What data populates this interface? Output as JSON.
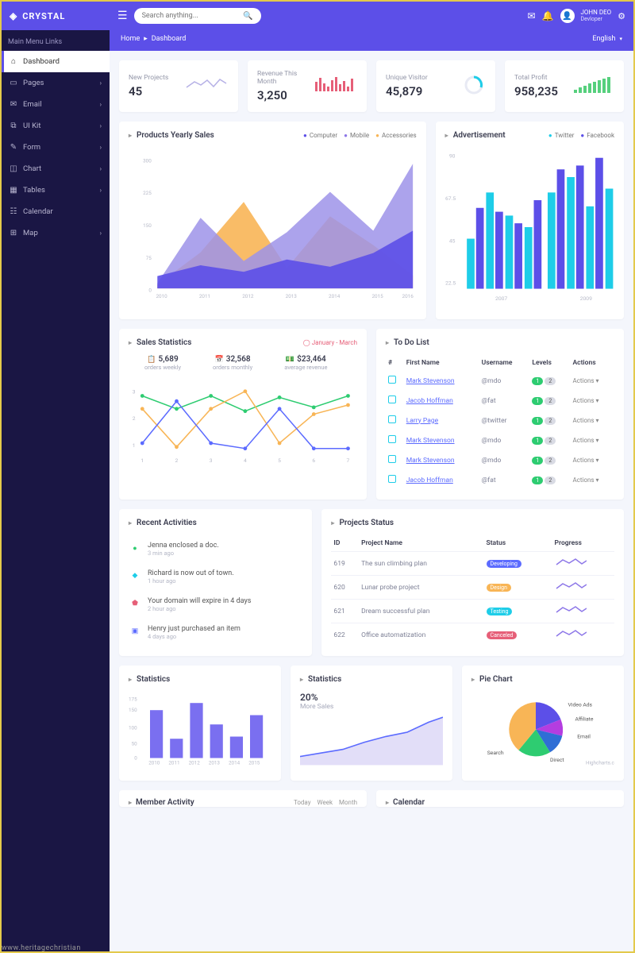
{
  "brand": "CRYSTAL",
  "search": {
    "placeholder": "Search anything..."
  },
  "user": {
    "name": "JOHN DEO",
    "role": "Devloper"
  },
  "breadcrumb": {
    "home": "Home",
    "current": "Dashboard",
    "lang": "English"
  },
  "sidebar": {
    "header": "Main Menu Links",
    "items": [
      {
        "icon": "⌂",
        "label": "Dashboard",
        "active": true,
        "chev": false
      },
      {
        "icon": "▭",
        "label": "Pages",
        "chev": true
      },
      {
        "icon": "✉",
        "label": "Email",
        "chev": true
      },
      {
        "icon": "⧉",
        "label": "UI Kit",
        "chev": true
      },
      {
        "icon": "✎",
        "label": "Form",
        "chev": true
      },
      {
        "icon": "◫",
        "label": "Chart",
        "chev": true
      },
      {
        "icon": "▦",
        "label": "Tables",
        "chev": true
      },
      {
        "icon": "☷",
        "label": "Calendar",
        "chev": false
      },
      {
        "icon": "⊞",
        "label": "Map",
        "chev": true
      }
    ]
  },
  "stat_cards": [
    {
      "label": "New Projects",
      "value": "45",
      "spark": "line",
      "color": "#b6b1e6"
    },
    {
      "label": "Revenue This Month",
      "value": "3,250",
      "spark": "bars",
      "color": "#e65f78"
    },
    {
      "label": "Unique Visitor",
      "value": "45,879",
      "spark": "donut",
      "color": "#1ecde8"
    },
    {
      "label": "Total Profit",
      "value": "958,235",
      "spark": "steps",
      "color": "#56d07d"
    }
  ],
  "products_sales": {
    "title": "Products Yearly Sales",
    "legend": [
      "Computer",
      "Mobile",
      "Accessories"
    ]
  },
  "advert": {
    "title": "Advertisement",
    "legend": [
      "Twitter",
      "Facebook"
    ]
  },
  "chart_data": {
    "products_sales": {
      "type": "area",
      "x": [
        2010,
        2011,
        2012,
        2013,
        2014,
        2015,
        2016
      ],
      "ylim": [
        0,
        300
      ],
      "yticks": [
        0,
        75,
        150,
        225,
        300
      ],
      "series": [
        {
          "name": "Computer",
          "values": [
            30,
            55,
            40,
            70,
            52,
            85,
            135
          ]
        },
        {
          "name": "Mobile",
          "values": [
            12,
            165,
            65,
            130,
            225,
            135,
            290
          ]
        },
        {
          "name": "Accessories",
          "values": [
            10,
            75,
            200,
            45,
            170,
            95,
            30
          ]
        }
      ]
    },
    "advert": {
      "type": "bar",
      "x": [
        2007,
        2009
      ],
      "ylim": [
        22.5,
        90
      ],
      "yticks": [
        22.5,
        45,
        67.5,
        90
      ],
      "series": [
        {
          "name": "Twitter",
          "groups": [
            [
              45,
              72,
              60,
              55
            ],
            [
              72,
              82,
              65,
              78
            ]
          ]
        },
        {
          "name": "Facebook",
          "groups": [
            [
              62,
              60,
              55,
              70
            ],
            [
              84,
              88,
              90,
              86
            ]
          ]
        }
      ]
    },
    "sales_stats": {
      "type": "line",
      "x": [
        1,
        2,
        3,
        4,
        5,
        6,
        7
      ],
      "yticks": [
        1,
        2,
        3
      ],
      "series": [
        {
          "name": "green",
          "values": [
            2.8,
            2.2,
            2.8,
            2.1,
            2.7,
            2.3,
            2.8
          ]
        },
        {
          "name": "orange",
          "values": [
            2.2,
            1.0,
            2.2,
            2.9,
            1.2,
            2.0,
            2.4
          ]
        },
        {
          "name": "blue",
          "values": [
            1.2,
            2.5,
            1.2,
            1.0,
            2.2,
            1.0,
            1.0
          ]
        }
      ]
    },
    "bottom_stats": {
      "type": "bar",
      "x": [
        2010,
        2011,
        2012,
        2013,
        2014,
        2015
      ],
      "yticks": [
        0,
        50,
        100,
        150,
        175
      ],
      "values": [
        150,
        60,
        170,
        105,
        65,
        135
      ]
    },
    "bottom_line": {
      "type": "line",
      "x": [
        0,
        10
      ],
      "ylim": [
        0,
        50
      ]
    },
    "pie": {
      "type": "pie",
      "slices": [
        {
          "name": "Video Ads",
          "value": 20,
          "color": "#5c4fe8"
        },
        {
          "name": "Affiliate",
          "value": 13,
          "color": "#b43de0"
        },
        {
          "name": "Email",
          "value": 12,
          "color": "#2f6ed5"
        },
        {
          "name": "Direct",
          "value": 20,
          "color": "#2ecc71"
        },
        {
          "name": "Search",
          "value": 35,
          "color": "#f8b556"
        }
      ]
    }
  },
  "sales_stats": {
    "title": "Sales Statistics",
    "period": "January - March",
    "metrics": [
      {
        "icon": "📋",
        "value": "5,689",
        "label": "orders weekly"
      },
      {
        "icon": "📅",
        "value": "32,568",
        "label": "orders monthly"
      },
      {
        "icon": "💵",
        "value": "$23,464",
        "label": "average revenue"
      }
    ]
  },
  "todo": {
    "title": "To Do List",
    "columns": [
      "#",
      "First Name",
      "Username",
      "Levels",
      "Actions"
    ],
    "rows": [
      {
        "name": "Mark Stevenson",
        "user": "@mdo"
      },
      {
        "name": "Jacob Hoffman",
        "user": "@fat"
      },
      {
        "name": "Larry Page",
        "user": "@twitter"
      },
      {
        "name": "Mark Stevenson",
        "user": "@mdo"
      },
      {
        "name": "Mark Stevenson",
        "user": "@mdo"
      },
      {
        "name": "Jacob Hoffman",
        "user": "@fat"
      }
    ],
    "action_label": "Actions"
  },
  "recent": {
    "title": "Recent Activities",
    "items": [
      {
        "icon": "●",
        "iconColor": "#2ecc71",
        "text": "Jenna enclosed a doc.",
        "time": "3 min ago"
      },
      {
        "icon": "◆",
        "iconColor": "#1ecde8",
        "text": "Richard is now out of town.",
        "time": "1 hour ago"
      },
      {
        "icon": "⬟",
        "iconColor": "#e65f78",
        "text": "Your domain will expire in 4 days",
        "time": "2 hour ago"
      },
      {
        "icon": "▣",
        "iconColor": "#5c6bff",
        "text": "Henry just purchased an item",
        "time": "4 days ago"
      }
    ]
  },
  "projects": {
    "title": "Projects Status",
    "columns": [
      "ID",
      "Project Name",
      "Status",
      "Progress"
    ],
    "rows": [
      {
        "id": "619",
        "name": "The sun climbing plan",
        "status": "Developing",
        "cls": "bd-dev"
      },
      {
        "id": "620",
        "name": "Lunar probe project",
        "status": "Design",
        "cls": "bd-dsgn"
      },
      {
        "id": "621",
        "name": "Dream successful plan",
        "status": "Testing",
        "cls": "bd-test"
      },
      {
        "id": "622",
        "name": "Office automatization",
        "status": "Canceled",
        "cls": "bd-cancel"
      }
    ]
  },
  "bottom": {
    "stats_title": "Statistics",
    "stats2_title": "Statistics",
    "stats2_percent": "20%",
    "stats2_sub": "More Sales",
    "pie_title": "Pie Chart",
    "pie_credit": "Highcharts.com"
  },
  "cutoff": {
    "member": "Member Activity",
    "tabs": [
      "Today",
      "Week",
      "Month"
    ],
    "calendar": "Calendar"
  },
  "watermark": "www.heritagechristian"
}
